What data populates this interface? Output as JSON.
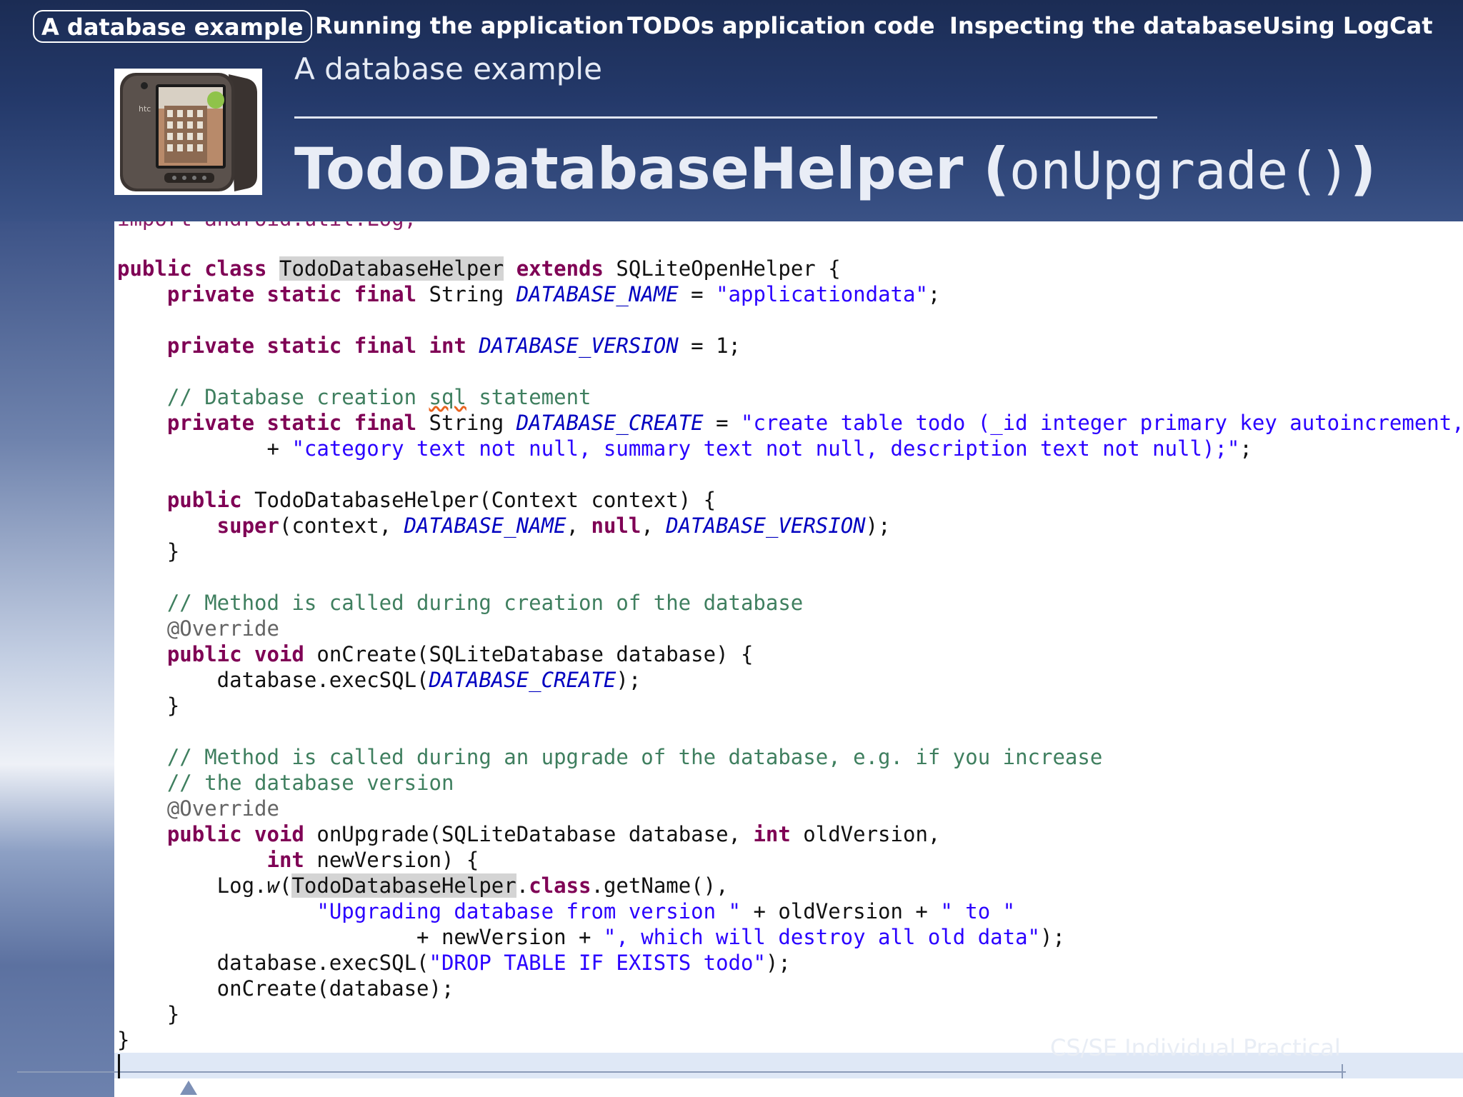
{
  "nav": {
    "items": [
      {
        "label": "A database example",
        "active": true
      },
      {
        "label": "Running the application",
        "active": false
      },
      {
        "label": "TODOs application code",
        "active": false
      },
      {
        "label": "Inspecting the database",
        "active": false
      },
      {
        "label": "Using LogCat",
        "active": false
      }
    ]
  },
  "section_title": "A database example",
  "frame_title": {
    "main": "TodoDatabaseHelper",
    "open_paren": "(",
    "method": "onUpgrade()",
    "close_paren": ")"
  },
  "phone_image": {
    "brand_text": "htc",
    "icon": "android-phone-image"
  },
  "code": {
    "cropped_line": "import android.util.Log;",
    "lines": {
      "l1_kw": "public class ",
      "l1_hl": "TodoDatabaseHelper",
      "l1_kw2": " extends",
      "l1_rest": " SQLiteOpenHelper {",
      "l2_kw": "    private static final",
      "l2_rest": " String ",
      "l2_fd": "DATABASE_NAME",
      "l2_eq": " = ",
      "l2_st": "\"applicationdata\"",
      "l2_end": ";",
      "l3_kw": "    private static final int",
      "l3_sp": " ",
      "l3_fd": "DATABASE_VERSION",
      "l3_rest": " = 1;",
      "l4_cm1": "    // Database creation ",
      "l4_sq": "sql",
      "l4_cm2": " statement",
      "l5_kw": "    private static final",
      "l5_rest": " String ",
      "l5_fd": "DATABASE_CREATE",
      "l5_eq": " = ",
      "l5_st": "\"create table todo (_id integer primary key autoincrement, \"",
      "l6_pre": "            + ",
      "l6_st": "\"category text not null, summary text not null, description text not null);\"",
      "l6_end": ";",
      "l7_kw": "    public",
      "l7_rest": " TodoDatabaseHelper(Context context) {",
      "l8_kw": "        super",
      "l8_a": "(context, ",
      "l8_fd1": "DATABASE_NAME",
      "l8_b": ", ",
      "l8_kw2": "null",
      "l8_c": ", ",
      "l8_fd2": "DATABASE_VERSION",
      "l8_d": ");",
      "l9": "    }",
      "l10_cm": "    // Method is called during creation of the database",
      "l11_an": "    @Override",
      "l12_kw": "    public void",
      "l12_rest": " onCreate(SQLiteDatabase database) {",
      "l13_a": "        database.execSQL(",
      "l13_fd": "DATABASE_CREATE",
      "l13_b": ");",
      "l14": "    }",
      "l15_cm": "    // Method is called during an upgrade of the database, e.g. if you increase",
      "l16_cm": "    // the database version",
      "l17_an": "    @Override",
      "l18_kw": "    public void",
      "l18_a": " onUpgrade(SQLiteDatabase database, ",
      "l18_kw2": "int",
      "l18_b": " oldVersion,",
      "l19_kw": "            int",
      "l19_rest": " newVersion) {",
      "l20_a": "        Log.",
      "l20_w": "w",
      "l20_b": "(",
      "l20_hl": "TodoDatabaseHelper",
      "l20_c": ".",
      "l20_kw": "class",
      "l20_d": ".getName(),",
      "l21_pre": "                ",
      "l21_st1": "\"Upgrading database from version \"",
      "l21_a": " + oldVersion + ",
      "l21_st2": "\" to \"",
      "l22_pre": "                        + newVersion + ",
      "l22_st": "\", which will destroy all old data\"",
      "l22_end": ");",
      "l23_a": "        database.execSQL(",
      "l23_st": "\"DROP TABLE IF EXISTS todo\"",
      "l23_b": ");",
      "l24": "        onCreate(database);",
      "l25": "    }",
      "l26": "}"
    }
  },
  "footer": {
    "text": "CS/SE Individual Practical"
  },
  "colors": {
    "keyword": "#7f0055",
    "comment": "#3f7f5f",
    "string": "#2a00ff",
    "field": "#0000c0",
    "header_bg": "#1b2c54",
    "highlight": "#d4d4d4"
  }
}
